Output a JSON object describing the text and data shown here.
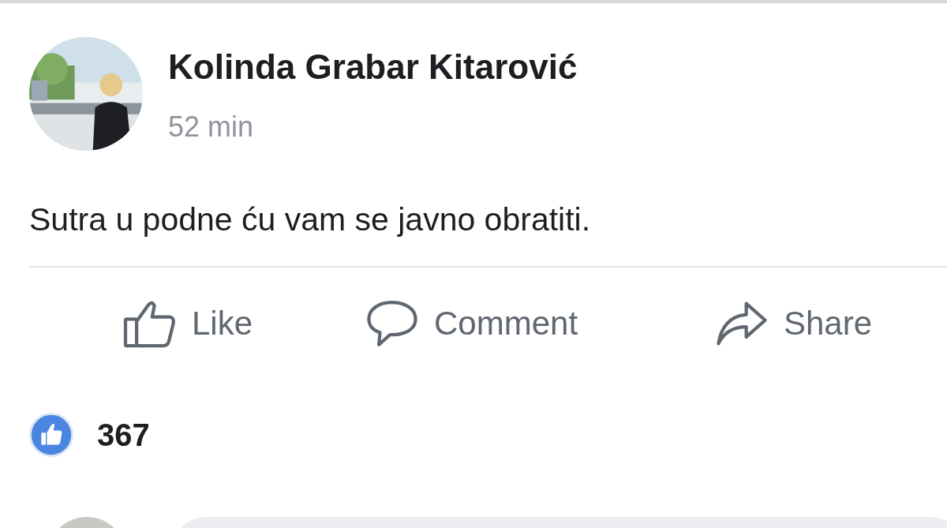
{
  "post": {
    "author": "Kolinda Grabar Kitarović",
    "time": "52 min",
    "text": "Sutra u podne ću vam se javno obratiti."
  },
  "actions": [
    {
      "kind": "like",
      "label": "Like"
    },
    {
      "kind": "comment",
      "label": "Comment"
    },
    {
      "kind": "share",
      "label": "Share"
    }
  ],
  "reactions": {
    "count": "367"
  }
}
